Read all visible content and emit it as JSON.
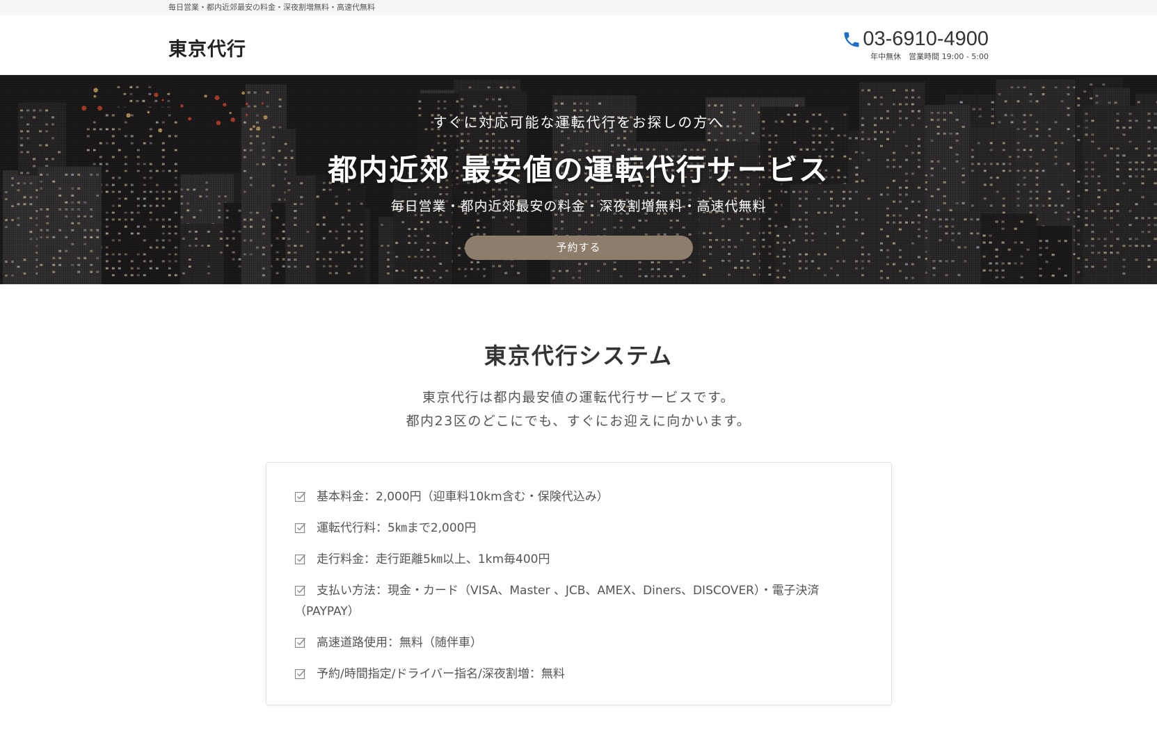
{
  "topbar": {
    "text": "毎日営業・都内近郊最安の料金・深夜割増無料・高速代無料"
  },
  "header": {
    "logo": "東京代行",
    "phone": "03-6910-4900",
    "hours": "年中無休　営業時間 19:00 - 5:00",
    "phone_icon": "phone-icon",
    "accent_color": "#1e6fc9"
  },
  "hero": {
    "kicker": "すぐに対応可能な運転代行をお探しの方へ",
    "title": "都内近郊 最安値の運転代行サービス",
    "subtitle": "毎日営業・都内近郊最安の料金・深夜割増無料・高速代無料",
    "button_label": "予約する",
    "button_color": "#8e7d6a"
  },
  "system": {
    "title": "東京代行システム",
    "desc_line1": "東京代行は都内最安値の運転代行サービスです。",
    "desc_line2": "都内23区のどこにでも、すぐにお迎えに向かいます。"
  },
  "features": [
    {
      "text": "基本料金：2,000円（迎車料10km含む・保険代込み）"
    },
    {
      "text": "運転代行料：5㎞まで2,000円"
    },
    {
      "text": "走行料金：走行距離5㎞以上、1km毎400円"
    },
    {
      "text": "支払い方法：現金・カード（VISA、Master 、JCB、AMEX、Diners、DISCOVER）・電子決済",
      "continued": "（PAYPAY）"
    },
    {
      "text": "高速道路使用：無料（随伴車）"
    },
    {
      "text": "予約/時間指定/ドライバー指名/深夜割増：無料"
    }
  ]
}
